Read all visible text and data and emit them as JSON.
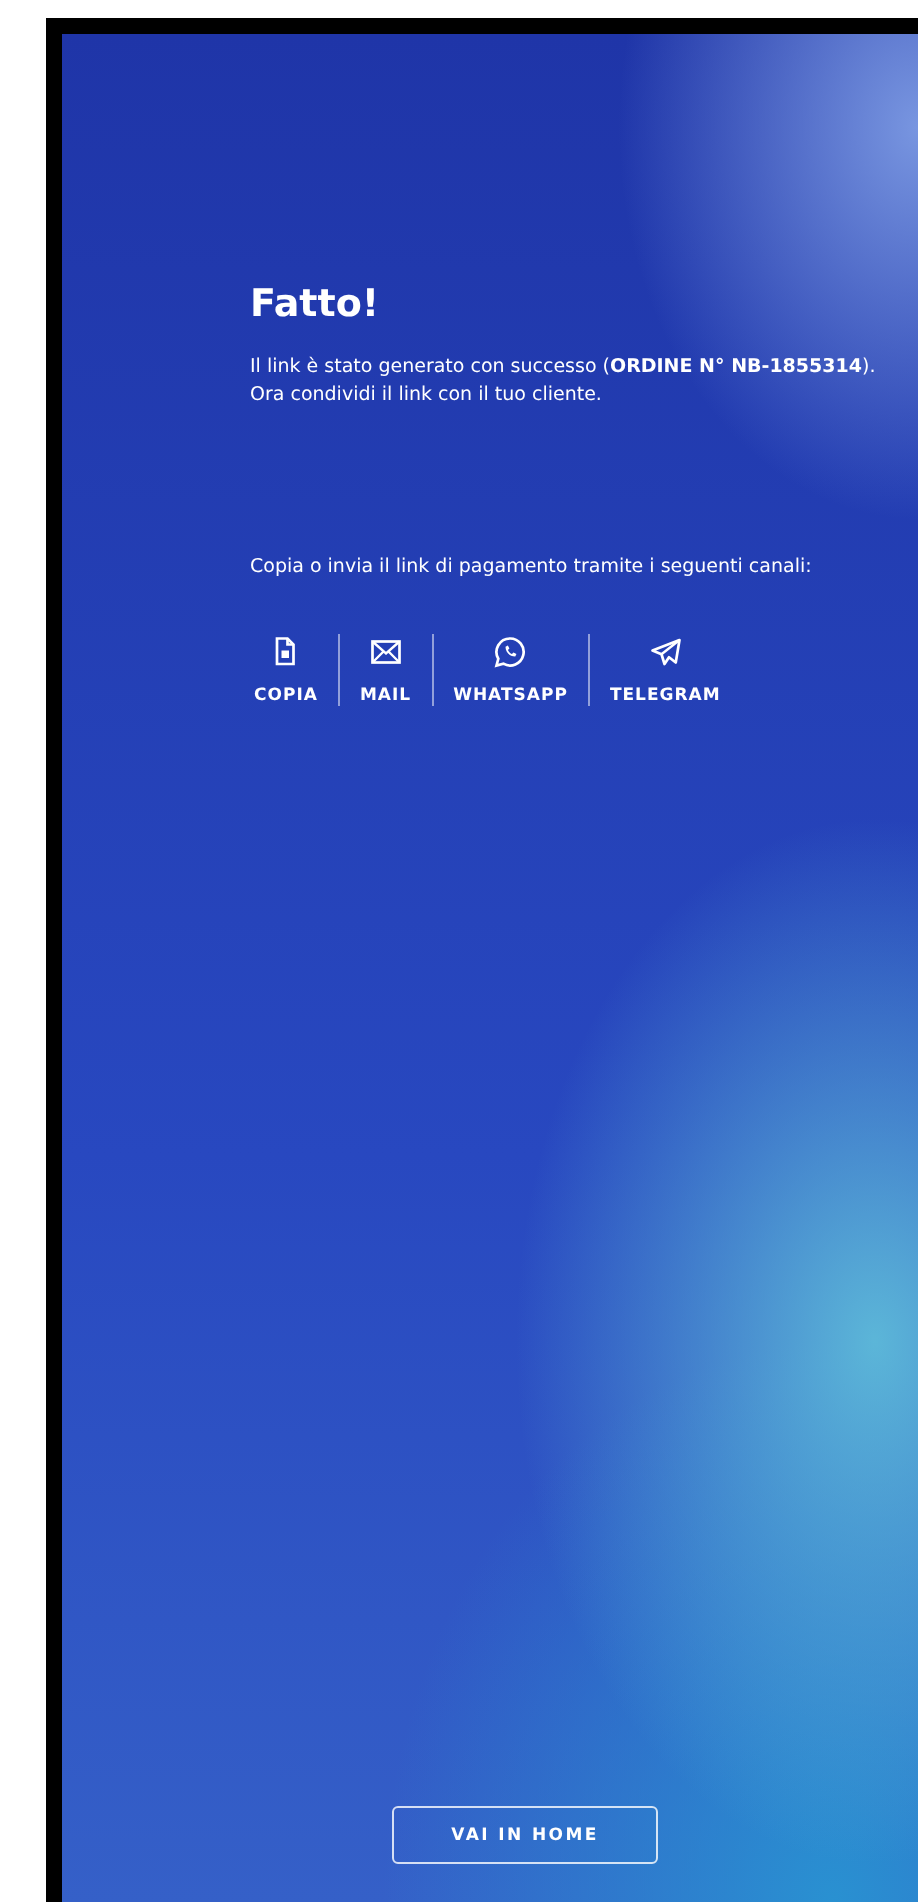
{
  "title": "Fatto!",
  "message": "Il link è stato generato con successo (**ORDINE N° NB-1855314**).",
  "message_2": "Ora condividi il link con il tuo cliente.",
  "instructions": "Copia o invia il link di pagamento tramite i seguenti canali:",
  "channels": [
    {
      "kind": "copy",
      "label": "COPIA"
    },
    {
      "kind": "mail",
      "label": "MAIL"
    },
    {
      "kind": "whatsapp",
      "label": "WHATSAPP"
    },
    {
      "kind": "telegram",
      "label": "TELEGRAM"
    }
  ],
  "home_button": "VAI IN HOME"
}
